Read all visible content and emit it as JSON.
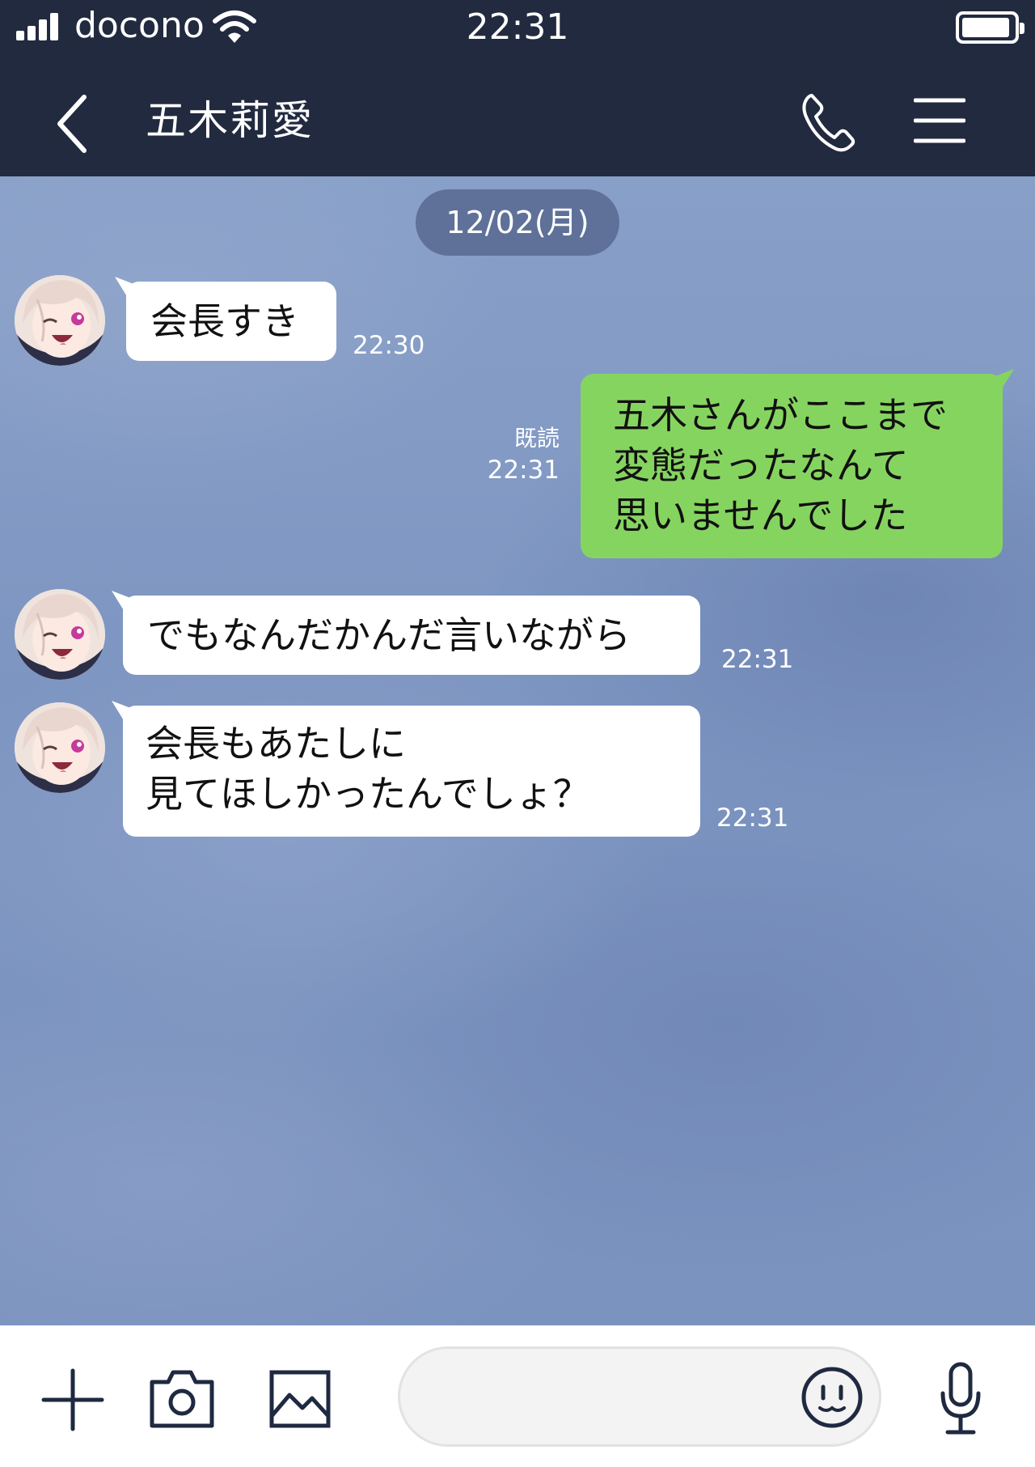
{
  "status_bar": {
    "carrier": "docono",
    "time": "22:31"
  },
  "header": {
    "contact_name": "五木莉愛"
  },
  "chat": {
    "date_label": "12/02(月)",
    "messages": [
      {
        "sender": "contact",
        "lines": [
          "会長すき"
        ],
        "time": "22:30"
      },
      {
        "sender": "me",
        "lines": [
          "五木さんがここまで",
          "変態だったなんて",
          "思いませんでした"
        ],
        "read_label": "既読",
        "time": "22:31"
      },
      {
        "sender": "contact",
        "lines": [
          "でもなんだかんだ言いながら"
        ],
        "time": "22:31"
      },
      {
        "sender": "contact",
        "lines": [
          "会長もあたしに",
          "見てほしかったんでしょ？"
        ],
        "time": "22:31"
      }
    ]
  },
  "input_bar": {
    "message_placeholder": ""
  },
  "icons": {
    "back": "chevron-left-icon",
    "call": "phone-icon",
    "menu": "hamburger-menu-icon",
    "add": "plus-icon",
    "camera": "camera-icon",
    "image": "image-icon",
    "emoji": "smiley-icon",
    "voice": "microphone-icon"
  },
  "colors": {
    "header_bg": "#222a40",
    "chat_bg": "#7f97c2",
    "incoming_bubble": "#ffffff",
    "outgoing_bubble": "#86d460",
    "date_pill": "#5f7199",
    "icon_stroke": "#1f2940"
  }
}
